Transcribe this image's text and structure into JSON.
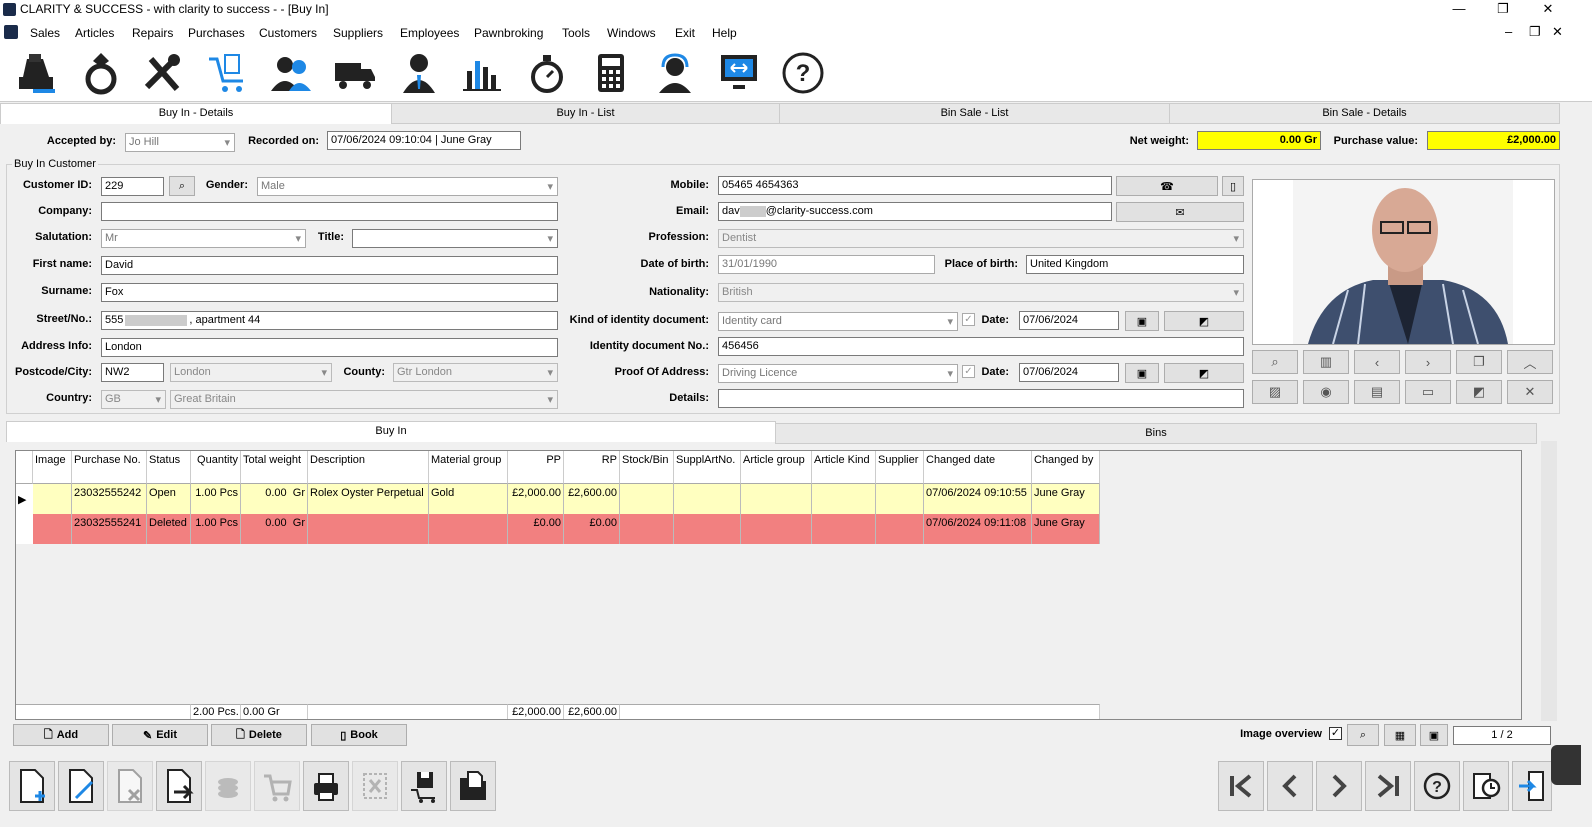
{
  "window": {
    "title": "CLARITY & SUCCESS  - with clarity to success - - [Buy In]"
  },
  "menu": [
    "Sales",
    "Articles",
    "Repairs",
    "Purchases",
    "Customers",
    "Suppliers",
    "Employees",
    "Pawnbroking",
    "Tools",
    "Windows",
    "Exit",
    "Help"
  ],
  "tabs": [
    "Buy In - Details",
    "Buy In - List",
    "Bin Sale - List",
    "Bin Sale - Details"
  ],
  "header": {
    "accepted_by_label": "Accepted by:",
    "accepted_by": "Jo Hill",
    "recorded_on_label": "Recorded on:",
    "recorded_on": "07/06/2024 09:10:04 | June Gray",
    "net_weight_label": "Net weight:",
    "net_weight": "0.00 Gr",
    "purchase_value_label": "Purchase value:",
    "purchase_value": "£2,000.00"
  },
  "customer": {
    "group_title": "Buy In Customer",
    "customer_id_label": "Customer ID:",
    "customer_id": "229",
    "gender_label": "Gender:",
    "gender": "Male",
    "company_label": "Company:",
    "company": "",
    "salutation_label": "Salutation:",
    "salutation": "Mr",
    "title_label": "Title:",
    "title": "",
    "first_name_label": "First name:",
    "first_name": "David",
    "surname_label": "Surname:",
    "surname": "Fox",
    "street_label": "Street/No.:",
    "street_prefix": "555",
    "street_suffix": ", apartment 44",
    "address_info_label": "Address Info:",
    "address_info": "London",
    "postcode_label": "Postcode/City:",
    "postcode": "NW2",
    "city": "London",
    "county_label": "County:",
    "county": "Gtr London",
    "country_label": "Country:",
    "country_code": "GB",
    "country": "Great Britain",
    "mobile_label": "Mobile:",
    "mobile": "05465 4654363",
    "email_label": "Email:",
    "email_prefix": "dav",
    "email_suffix": "@clarity-success.com",
    "profession_label": "Profession:",
    "profession": "Dentist",
    "dob_label": "Date of birth:",
    "dob": "31/01/1990",
    "pob_label": "Place of birth:",
    "pob": "United Kingdom",
    "nationality_label": "Nationality:",
    "nationality": "British",
    "id_kind_label": "Kind of identity document:",
    "id_kind": "Identity card",
    "date_label": "Date:",
    "id_date": "07/06/2024",
    "id_no_label": "Identity document No.:",
    "id_no": "456456",
    "proof_label": "Proof Of Address:",
    "proof": "Driving Licence",
    "proof_date": "07/06/2024",
    "details_label": "Details:",
    "details": ""
  },
  "lower_tabs": [
    "Buy In",
    "Bins"
  ],
  "table": {
    "columns": [
      "Image",
      "Purchase No.",
      "Status",
      "Quantity",
      "Total weight",
      "Description",
      "Material group",
      "PP",
      "RP",
      "Stock/Bin",
      "SupplArtNo.",
      "Article group",
      "Article Kind",
      "Supplier",
      "Changed date",
      "Changed by"
    ],
    "rows": [
      {
        "purchase_no": "23032555242",
        "status": "Open",
        "quantity": "1.00 Pcs",
        "weight": "0.00",
        "unit": "Gr",
        "description": "Rolex Oyster Perpetual",
        "material": "Gold",
        "pp": "£2,000.00",
        "rp": "£2,600.00",
        "changed_date": "07/06/2024 09:10:55",
        "changed_by": "June Gray",
        "color": "#ffffc0"
      },
      {
        "purchase_no": "23032555241",
        "status": "Deleted",
        "quantity": "1.00 Pcs",
        "weight": "0.00",
        "unit": "Gr",
        "description": "",
        "material": "",
        "pp": "£0.00",
        "rp": "£0.00",
        "changed_date": "07/06/2024 09:11:08",
        "changed_by": "June Gray",
        "color": "#f28080"
      }
    ],
    "footer": {
      "quantity": "2.00 Pcs.",
      "weight": "0.00 Gr",
      "pp": "£2,000.00",
      "rp": "£2,600.00"
    }
  },
  "actions": {
    "add": "Add",
    "edit": "Edit",
    "delete": "Delete",
    "book": "Book"
  },
  "image_overview_label": "Image overview",
  "pager": "1 / 2"
}
